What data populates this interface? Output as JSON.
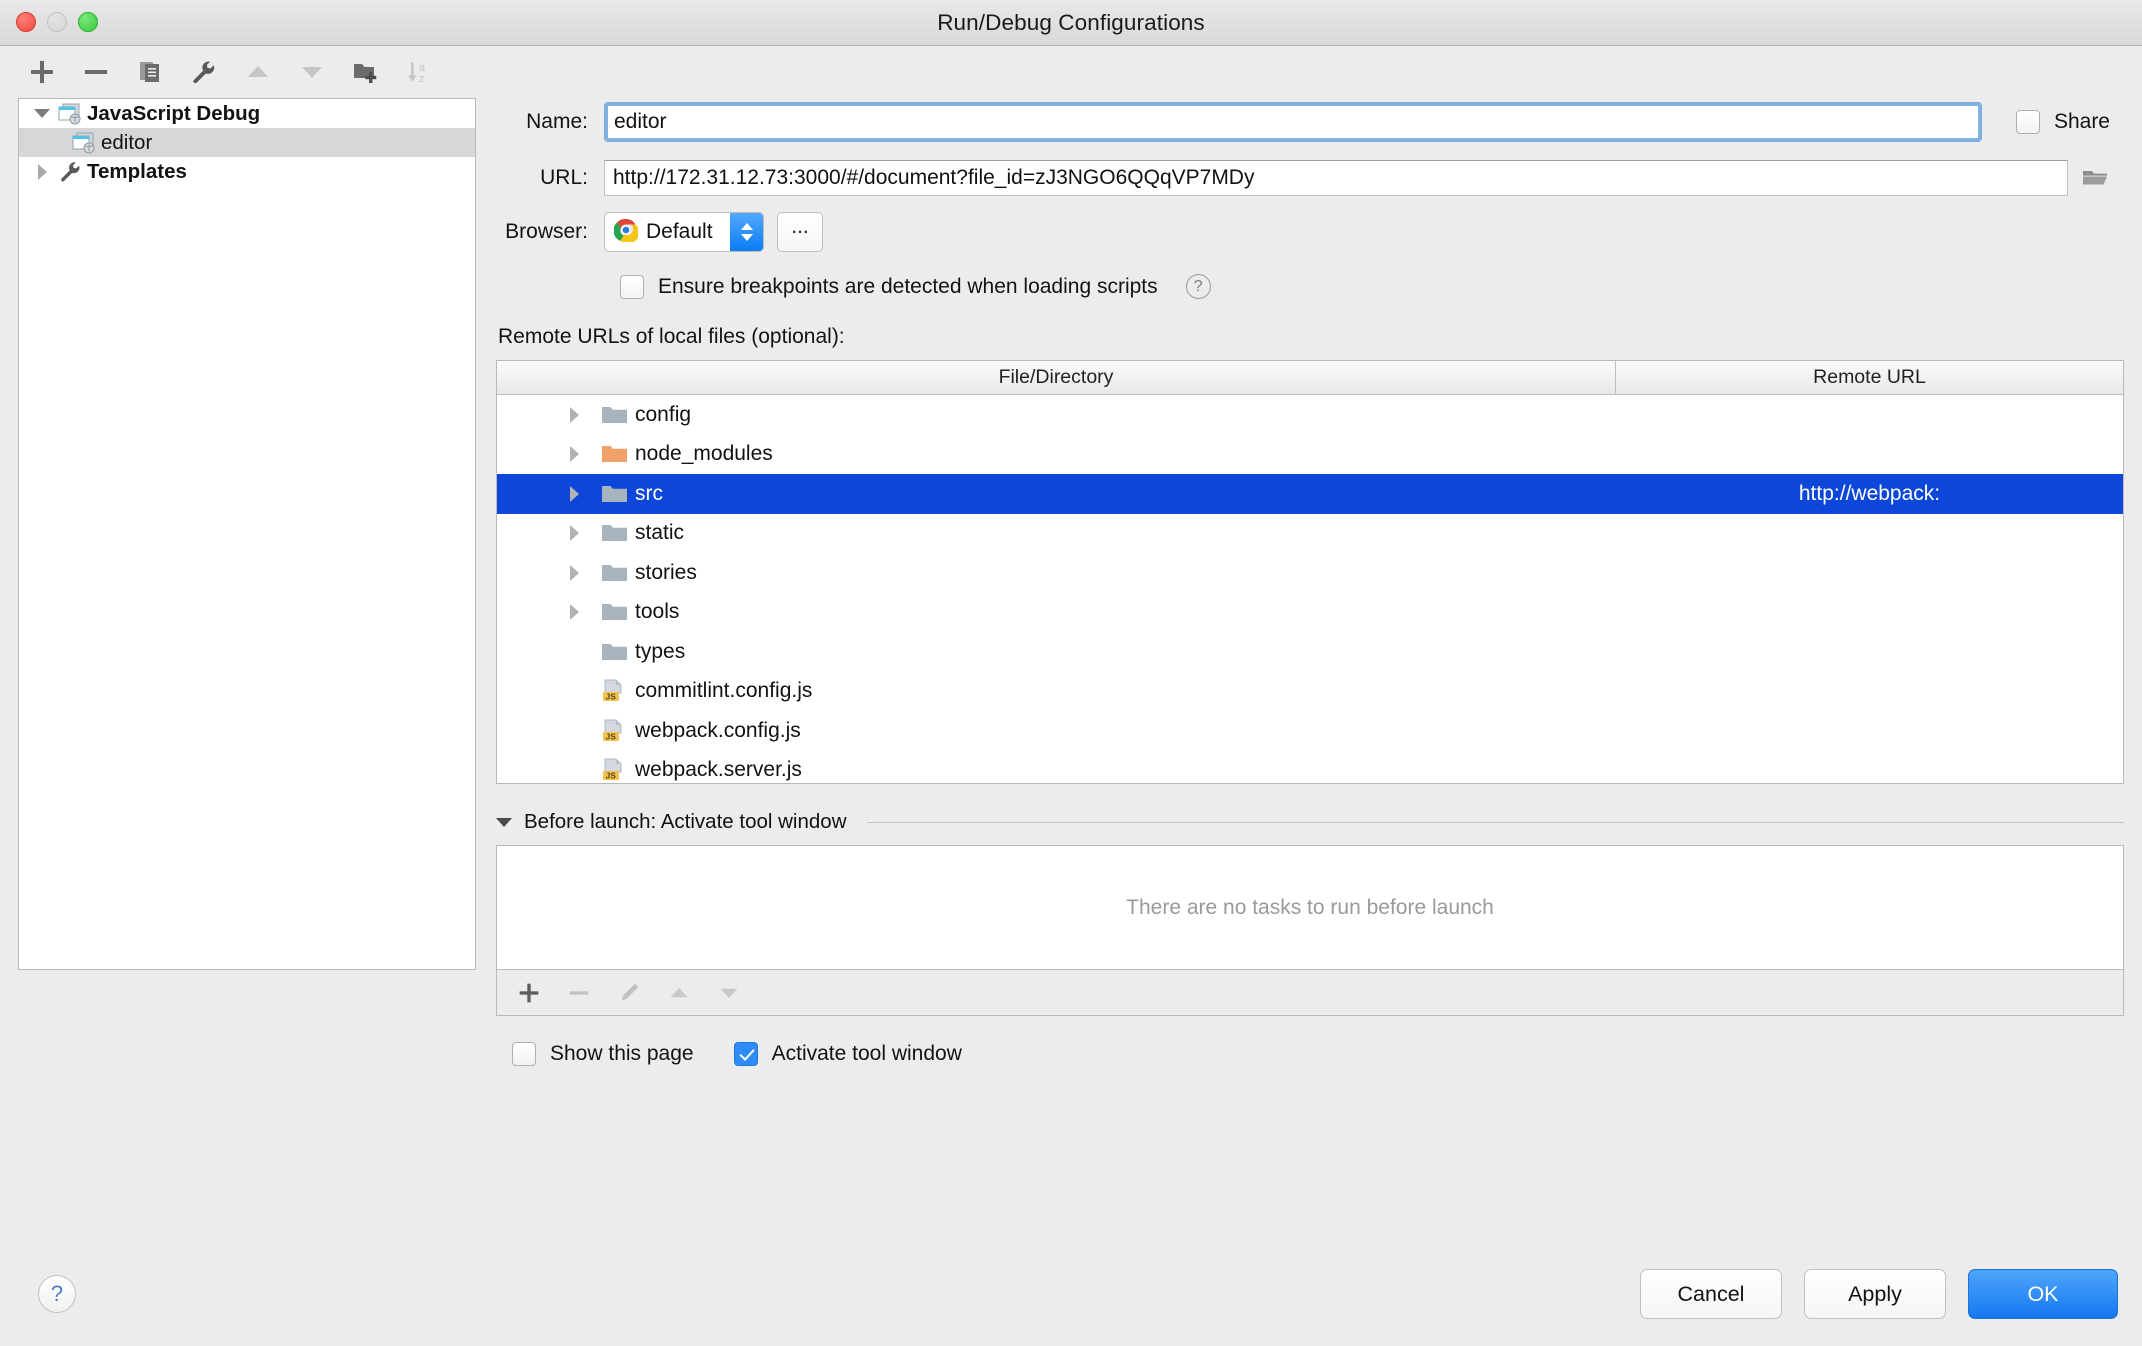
{
  "window": {
    "title": "Run/Debug Configurations",
    "traffic_lights": [
      "close",
      "minimize",
      "zoom"
    ]
  },
  "toolbar": {
    "buttons": [
      {
        "name": "add-button",
        "icon": "plus-icon",
        "enabled": true
      },
      {
        "name": "remove-button",
        "icon": "minus-icon",
        "enabled": true
      },
      {
        "name": "copy-configuration-button",
        "icon": "copy-icon",
        "enabled": true
      },
      {
        "name": "edit-templates-button",
        "icon": "wrench-icon",
        "enabled": true
      },
      {
        "name": "move-up-button",
        "icon": "triangle-up-icon",
        "enabled": false
      },
      {
        "name": "move-down-button",
        "icon": "triangle-down-icon",
        "enabled": false
      },
      {
        "name": "new-folder-button",
        "icon": "folder-plus-icon",
        "enabled": true
      },
      {
        "name": "sort-alphabetically-button",
        "icon": "sort-az-icon",
        "enabled": false
      }
    ]
  },
  "tree": {
    "nodes": [
      {
        "label": "JavaScript Debug",
        "icon": "javascript-debug-icon",
        "expanded": true,
        "level": 0,
        "selected": false
      },
      {
        "label": "editor",
        "icon": "javascript-debug-icon",
        "expanded": null,
        "level": 1,
        "selected": true
      },
      {
        "label": "Templates",
        "icon": "wrench-icon",
        "expanded": false,
        "level": 0,
        "selected": false
      }
    ]
  },
  "form": {
    "name_label": "Name:",
    "name_value": "editor",
    "share_label": "Share",
    "share_checked": false,
    "url_label": "URL:",
    "url_value": "http://172.31.12.73:3000/#/document?file_id=zJ3NGO6QQqVP7MDy",
    "browse_icon": "folder-open-icon",
    "browser_label": "Browser:",
    "browser_value": "Default",
    "browser_icon": "chrome-icon",
    "browser_more_label": "...",
    "ensure_breakpoints_label": "Ensure breakpoints are detected when loading scripts",
    "ensure_breakpoints_checked": false,
    "help_icon": "question-mark-icon",
    "remote_urls_label": "Remote URLs of local files (optional):"
  },
  "table": {
    "columns": [
      "File/Directory",
      "Remote URL"
    ],
    "rows": [
      {
        "name": "config",
        "icon": "folder-icon",
        "icon_color": "#a8b4bd",
        "expandable": true,
        "remote_url": "",
        "selected": false
      },
      {
        "name": "node_modules",
        "icon": "folder-icon",
        "icon_color": "#f0a068",
        "expandable": true,
        "remote_url": "",
        "selected": false
      },
      {
        "name": "src",
        "icon": "folder-icon",
        "icon_color": "#a8b4bd",
        "expandable": true,
        "remote_url": "http://webpack:",
        "selected": true
      },
      {
        "name": "static",
        "icon": "folder-icon",
        "icon_color": "#a8b4bd",
        "expandable": true,
        "remote_url": "",
        "selected": false
      },
      {
        "name": "stories",
        "icon": "folder-icon",
        "icon_color": "#a8b4bd",
        "expandable": true,
        "remote_url": "",
        "selected": false
      },
      {
        "name": "tools",
        "icon": "folder-icon",
        "icon_color": "#a8b4bd",
        "expandable": true,
        "remote_url": "",
        "selected": false
      },
      {
        "name": "types",
        "icon": "folder-icon",
        "icon_color": "#a8b4bd",
        "expandable": false,
        "remote_url": "",
        "selected": false
      },
      {
        "name": "commitlint.config.js",
        "icon": "js-file-icon",
        "icon_color": "#f2c14e",
        "expandable": false,
        "remote_url": "",
        "selected": false
      },
      {
        "name": "webpack.config.js",
        "icon": "js-file-icon",
        "icon_color": "#f2c14e",
        "expandable": false,
        "remote_url": "",
        "selected": false
      },
      {
        "name": "webpack.server.js",
        "icon": "js-file-icon",
        "icon_color": "#f2c14e",
        "expandable": false,
        "remote_url": "",
        "selected": false
      }
    ]
  },
  "before_launch": {
    "header": "Before launch: Activate tool window",
    "expanded": true,
    "empty_text": "There are no tasks to run before launch",
    "toolbar": [
      {
        "name": "add-task-button",
        "icon": "plus-icon",
        "enabled": true
      },
      {
        "name": "remove-task-button",
        "icon": "minus-icon",
        "enabled": false
      },
      {
        "name": "edit-task-button",
        "icon": "pencil-icon",
        "enabled": false
      },
      {
        "name": "move-task-up-button",
        "icon": "triangle-up-icon",
        "enabled": false
      },
      {
        "name": "move-task-down-button",
        "icon": "triangle-down-icon",
        "enabled": false
      }
    ],
    "show_this_page_label": "Show this page",
    "show_this_page_checked": false,
    "activate_tool_window_label": "Activate tool window",
    "activate_tool_window_checked": true
  },
  "footer": {
    "help_label": "?",
    "cancel_label": "Cancel",
    "apply_label": "Apply",
    "ok_label": "OK"
  },
  "colors": {
    "selection_blue": "#0d47d9",
    "accent_blue": "#1478ef",
    "window_bg": "#ececec",
    "folder_gray": "#a8b4bd",
    "folder_orange": "#f0a068"
  }
}
